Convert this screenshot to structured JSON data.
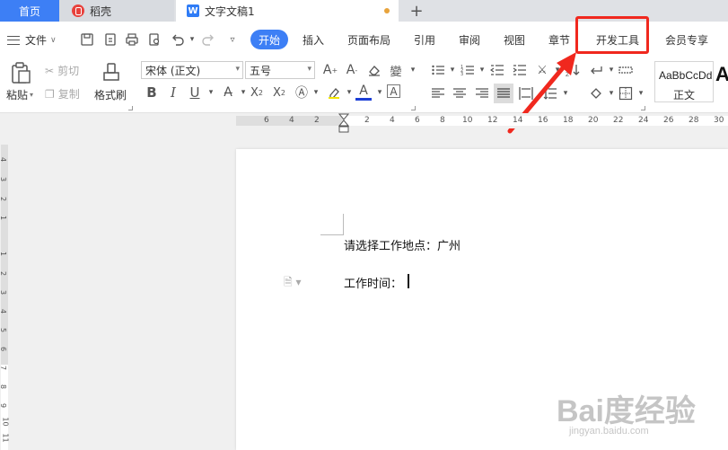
{
  "tabs": {
    "home": "首页",
    "docer": "稻壳",
    "document": "文字文稿1"
  },
  "menu": {
    "file": "文件",
    "items": [
      "开始",
      "插入",
      "页面布局",
      "引用",
      "审阅",
      "视图",
      "章节",
      "开发工具",
      "会员专享"
    ]
  },
  "ribbon": {
    "paste": "粘贴",
    "cut": "剪切",
    "copy": "复制",
    "format_painter": "格式刷",
    "font_name": "宋体 (正文)",
    "font_size": "五号",
    "style_sample": "AaBbCcDd",
    "style_name": "正文",
    "style_next": "A"
  },
  "ruler": {
    "h_numbers": [
      "6",
      "4",
      "2",
      "2",
      "4",
      "6",
      "8",
      "10",
      "12",
      "14",
      "16",
      "18",
      "20",
      "22",
      "24",
      "26",
      "28",
      "30"
    ],
    "v_numbers": [
      "4",
      "3",
      "2",
      "1",
      "1",
      "2",
      "3",
      "4",
      "5",
      "6",
      "7",
      "8",
      "9",
      "10",
      "11"
    ]
  },
  "document": {
    "line1": "请选择工作地点：广州",
    "line2": "工作时间："
  },
  "watermark": {
    "main": "Bai度经验",
    "sub": "jingyan.baidu.com"
  },
  "colors": {
    "accent": "#3d7ff5",
    "highlight": "#f0281e"
  }
}
